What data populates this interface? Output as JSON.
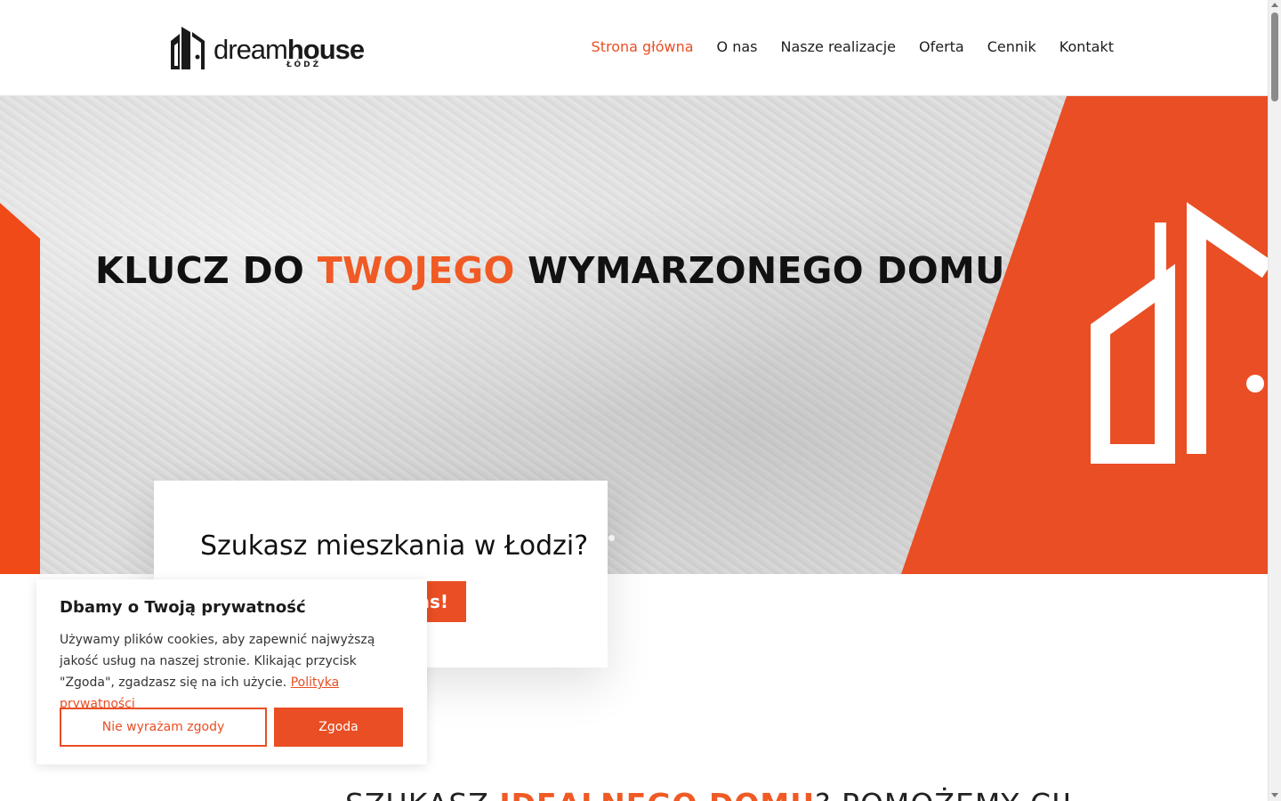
{
  "brand": {
    "logo_word_light": "dream",
    "logo_word_bold": "house",
    "logo_sub": "ŁÓDŹ",
    "accent_color": "#e94e24"
  },
  "nav": {
    "items": [
      {
        "label": "Strona główna",
        "active": true
      },
      {
        "label": "O nas",
        "active": false
      },
      {
        "label": "Nasze realizacje",
        "active": false
      },
      {
        "label": "Oferta",
        "active": false
      },
      {
        "label": "Cennik",
        "active": false
      },
      {
        "label": "Kontakt",
        "active": false
      }
    ]
  },
  "hero": {
    "title_part1": "KLUCZ DO ",
    "title_accent": "TWOJEGO",
    "title_part2": " WYMARZONEGO DOMU"
  },
  "card": {
    "title": "Szukasz mieszkania w Łodzi?",
    "button_visible_text": "as!"
  },
  "cookie": {
    "title": "Dbamy o Twoją prywatność",
    "text": "Używamy plików cookies, aby zapewnić najwyższą jakość usług na naszej stronie. Klikając przycisk \"Zgoda\", zgadzasz się na ich użycie.",
    "link": "Polityka prywatności",
    "reject_label": "Nie wyrażam zgody",
    "accept_label": "Zgoda"
  },
  "section": {
    "heading_part1": "SZUKASZ ",
    "heading_accent": "IDEALNEGO DOMU",
    "heading_part2": "? POMOŻEMY CI!"
  }
}
